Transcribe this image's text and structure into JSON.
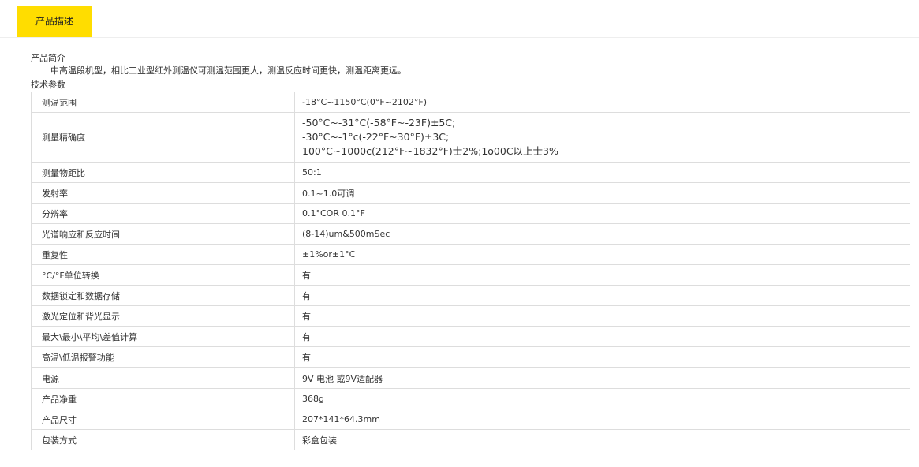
{
  "tab": {
    "label": "产品描述"
  },
  "intro": {
    "heading": "产品简介",
    "text": "中高温段机型，相比工业型红外测温仪可测温范围更大，测温反应时间更快，测温距离更远。"
  },
  "spec": {
    "heading": "技术参数",
    "rows": [
      {
        "label": "测温范围",
        "value": "-18°C~1150°C(0°F~2102°F)"
      },
      {
        "label": "测量精确度",
        "lines": [
          "-50°C~-31°C(-58°F~-23F)±5C;",
          "-30°C~-1°c(-22°F~30°F)±3C;",
          "100°C~1000c(212°F~1832°F)士2%;1o00C以上士3%"
        ]
      },
      {
        "label": "测量物距比",
        "value": "50:1"
      },
      {
        "label": "发射率",
        "value": "0.1~1.0可调"
      },
      {
        "label": "分辨率",
        "value": "0.1°COR 0.1°F"
      },
      {
        "label": "光谱响应和反应时间",
        "value": "(8-14)um&500mSec"
      },
      {
        "label": "重复性",
        "value": "±1%or±1°C"
      },
      {
        "label": "°C/°F单位转换",
        "value": "有"
      },
      {
        "label": "数据锁定和数据存储",
        "value": "有"
      },
      {
        "label": "激光定位和背光显示",
        "value": "有"
      },
      {
        "label": "最大\\最小\\平均\\差值计算",
        "value": "有"
      },
      {
        "label": "高温\\低温报警功能",
        "value": "有"
      },
      {
        "label": "电源",
        "value": "9V 电池 或9V适配器"
      },
      {
        "label": "产品净重",
        "value": "368g"
      },
      {
        "label": "产品尺寸",
        "value": "207*141*64.3mm"
      },
      {
        "label": "包装方式",
        "value": "彩盒包装"
      }
    ]
  }
}
